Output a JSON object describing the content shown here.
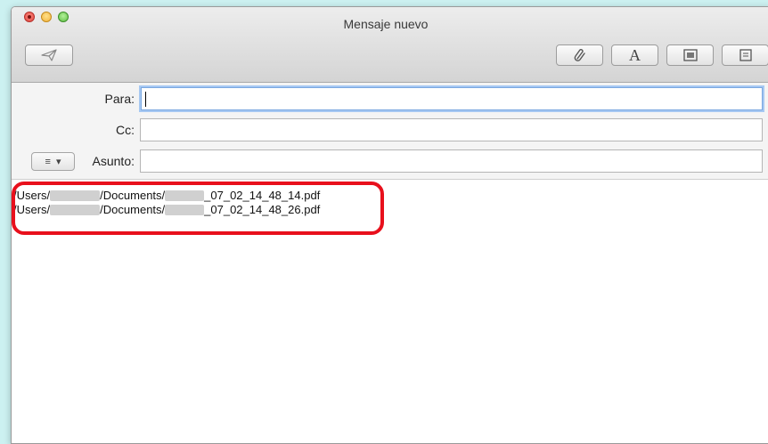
{
  "window": {
    "title": "Mensaje nuevo"
  },
  "toolbar": {
    "send_icon": "paper-plane-icon",
    "attach_icon": "paperclip-icon",
    "fonts_label": "A",
    "photo_icon": "photo-browser-icon",
    "template_icon": "stationery-icon"
  },
  "fields": {
    "to_label": "Para:",
    "to_value": "",
    "cc_label": "Cc:",
    "cc_value": "",
    "subject_label": "Asunto:",
    "subject_value": "",
    "header_menu_glyph": "≡",
    "header_menu_arrow": "▾"
  },
  "body": {
    "lines": [
      {
        "prefix": "/Users/",
        "middle": "/Documents/",
        "suffix": "_07_02_14_48_14.pdf"
      },
      {
        "prefix": "/Users/",
        "middle": "/Documents/",
        "suffix": "_07_02_14_48_26.pdf"
      }
    ]
  },
  "colors": {
    "highlight": "#e8101c",
    "background": "#ccf1f1"
  }
}
